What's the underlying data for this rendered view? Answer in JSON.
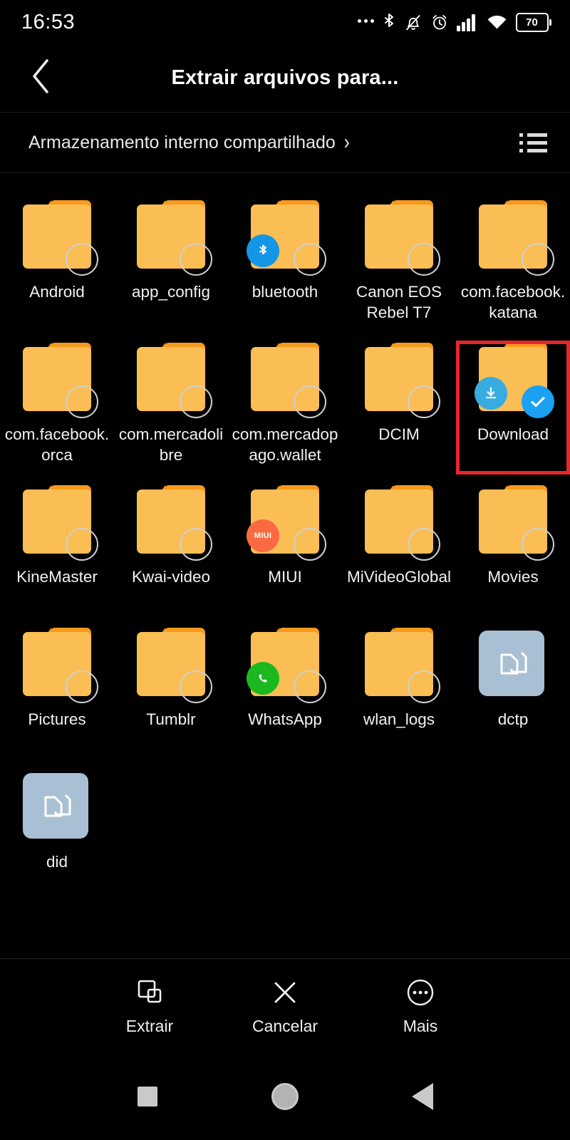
{
  "status_bar": {
    "time": "16:53",
    "battery_level": "70",
    "icons": [
      "more-dots-icon",
      "bluetooth-icon",
      "notifications-muted-icon",
      "alarm-clock-icon",
      "cellular-signal-icon",
      "wifi-icon",
      "battery-icon"
    ]
  },
  "header": {
    "title": "Extrair arquivos para...",
    "back_icon": "chevron-left-icon"
  },
  "breadcrumb": {
    "path": "Armazenamento interno compartilhado",
    "chevron": "›",
    "view_toggle_icon": "list-view-icon"
  },
  "colors": {
    "folder_body": "#FBBE54",
    "folder_tab": "#F89A1C",
    "file_tile": "#A9C0D4",
    "selected_blue": "#1BA1F2",
    "highlight_red": "#E7262B",
    "background": "#000000"
  },
  "items": [
    {
      "label": "Android",
      "type": "folder",
      "badge": null,
      "selected": false
    },
    {
      "label": "app_config",
      "type": "folder",
      "badge": null,
      "selected": false
    },
    {
      "label": "bluetooth",
      "type": "folder",
      "badge": "bluetooth",
      "selected": false
    },
    {
      "label": "Canon EOS Rebel T7",
      "type": "folder",
      "badge": null,
      "selected": false
    },
    {
      "label": "com.facebook.katana",
      "type": "folder",
      "badge": null,
      "selected": false
    },
    {
      "label": "com.facebook.orca",
      "type": "folder",
      "badge": null,
      "selected": false
    },
    {
      "label": "com.mercadolibre",
      "type": "folder",
      "badge": null,
      "selected": false
    },
    {
      "label": "com.mercadopago.wallet",
      "type": "folder",
      "badge": null,
      "selected": false
    },
    {
      "label": "DCIM",
      "type": "folder",
      "badge": null,
      "selected": false
    },
    {
      "label": "Download",
      "type": "folder",
      "badge": "download",
      "selected": true,
      "highlighted": true
    },
    {
      "label": "KineMaster",
      "type": "folder",
      "badge": null,
      "selected": false
    },
    {
      "label": "Kwai-video",
      "type": "folder",
      "badge": null,
      "selected": false
    },
    {
      "label": "MIUI",
      "type": "folder",
      "badge": "miui",
      "selected": false
    },
    {
      "label": "MiVideoGlobal",
      "type": "folder",
      "badge": null,
      "selected": false
    },
    {
      "label": "Movies",
      "type": "folder",
      "badge": null,
      "selected": false
    },
    {
      "label": "Pictures",
      "type": "folder",
      "badge": null,
      "selected": false
    },
    {
      "label": "Tumblr",
      "type": "folder",
      "badge": null,
      "selected": false
    },
    {
      "label": "WhatsApp",
      "type": "folder",
      "badge": "whatsapp",
      "selected": false
    },
    {
      "label": "wlan_logs",
      "type": "folder",
      "badge": null,
      "selected": false
    },
    {
      "label": "dctp",
      "type": "file",
      "badge": null,
      "selected": false
    },
    {
      "label": "did",
      "type": "file",
      "badge": null,
      "selected": false
    }
  ],
  "badge_labels": {
    "miui": "MIUI"
  },
  "action_bar": [
    {
      "label": "Extrair",
      "icon": "extract-icon"
    },
    {
      "label": "Cancelar",
      "icon": "close-x-icon"
    },
    {
      "label": "Mais",
      "icon": "more-circle-icon"
    }
  ],
  "nav_bar": [
    {
      "icon": "recents-square-icon"
    },
    {
      "icon": "home-circle-icon"
    },
    {
      "icon": "back-triangle-icon"
    }
  ]
}
